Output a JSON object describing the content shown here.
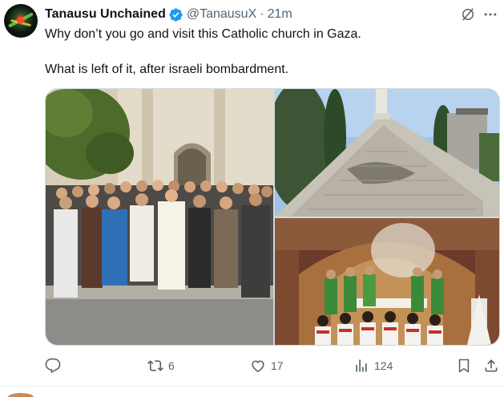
{
  "author": {
    "name": "Tanausu Unchained",
    "handle": "@TanausuX",
    "separator": "·",
    "time": "21m",
    "verified": true
  },
  "tweet": {
    "text_line_1": "Why don’t you go and visit this Catholic church in Gaza.",
    "text_line_2": "What is left of it, after israeli bombardment."
  },
  "media": [
    {
      "name": "group-photo",
      "icon": "photo"
    },
    {
      "name": "damaged-church-photo",
      "icon": "photo"
    },
    {
      "name": "mass-photo",
      "icon": "photo"
    }
  ],
  "actions": {
    "reply_icon": "reply-icon",
    "retweet_count": "6",
    "like_count": "17",
    "views_count": "124",
    "bookmark_icon": "bookmark-icon",
    "share_icon": "share-icon"
  },
  "colors": {
    "verified": "#1d9bf0",
    "secondary_text": "#536471",
    "primary_text": "#0f1419",
    "border": "#cfd9de"
  }
}
